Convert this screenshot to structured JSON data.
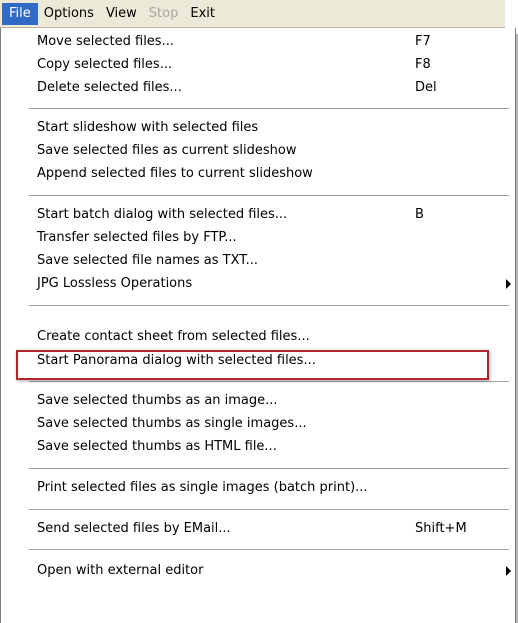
{
  "menubar": {
    "file": "File",
    "options": "Options",
    "view": "View",
    "stop": "Stop",
    "exit": "Exit"
  },
  "menu": {
    "move": "Move selected files...",
    "move_key": "F7",
    "copy": "Copy selected files...",
    "copy_key": "F8",
    "delete": "Delete selected files...",
    "delete_key": "Del",
    "start_slideshow": "Start slideshow with selected files",
    "save_slideshow": "Save selected files as current slideshow",
    "append_slideshow": "Append selected files to current slideshow",
    "batch": "Start batch dialog with selected files...",
    "batch_key": "B",
    "ftp": "Transfer selected files by FTP...",
    "save_names": "Save selected file names as TXT...",
    "jpg_lossless": "JPG Lossless Operations",
    "contact_sheet": "Create contact sheet from selected files...",
    "panorama": "Start Panorama dialog with selected files...",
    "thumbs_image": "Save selected thumbs as an image...",
    "thumbs_single": "Save selected thumbs as single images...",
    "thumbs_html": "Save selected thumbs as HTML file...",
    "print": "Print selected files as single images (batch print)...",
    "email": "Send selected files by EMail...",
    "email_key": "Shift+M",
    "external_editor": "Open with external editor"
  },
  "colors": {
    "menubar_bg": "#ECE9D8",
    "active_menu_bg": "#316AC5",
    "highlight_border": "#B0262A"
  }
}
